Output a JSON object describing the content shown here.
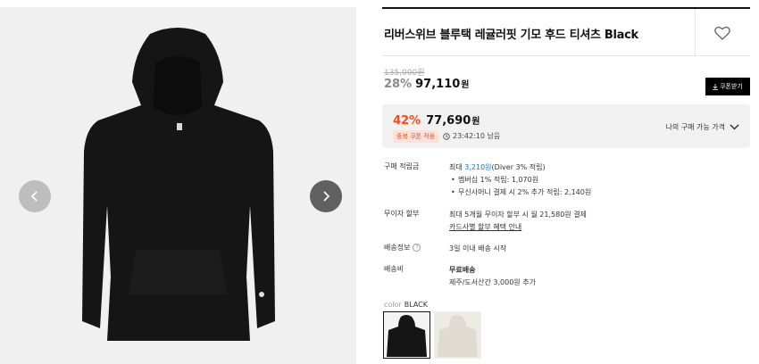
{
  "product": {
    "title": "리버스위브 블루택 레귤러핏 기모 후드 티셔츠 Black"
  },
  "price": {
    "original": "135,000원",
    "discount_pct": "28%",
    "sale": "97,110",
    "won": "원"
  },
  "coupon_button": {
    "label": "쿠폰받기"
  },
  "benefit": {
    "pct": "42%",
    "price": "77,690",
    "won": "원",
    "badge": "중복 쿠폰 적용",
    "timer": "23:42:10 남음",
    "my_price_label": "나의 구매 가능 가격"
  },
  "info": {
    "points": {
      "label": "구매 적립금",
      "max_prefix": "최대 ",
      "max_amount": "3,210원",
      "max_suffix": "(Diver 3% 적립)",
      "bullet1": "멤버십 1% 적립: 1,070원",
      "bullet2": "무신사머니 결제 시 2% 추가 적립: 2,140원"
    },
    "installment": {
      "label": "무이자 할부",
      "line1": "최대 5개월 무이자 할부 시 월 21,580원 결제",
      "link": "카드사별 할부 혜택 안내"
    },
    "shipping_info": {
      "label": "배송정보",
      "help": "?",
      "value": "3일 이내 배송 시작"
    },
    "shipping_fee": {
      "label": "배송비",
      "line1": "무료배송",
      "line2": "제주/도서산간 3,000원 추가"
    }
  },
  "color": {
    "label": "color",
    "selected": "BLACK",
    "swatches": [
      "black",
      "ivory"
    ]
  },
  "colors": {
    "accent": "#ff4a1c",
    "link": "#0078ff",
    "product": "#151515"
  }
}
